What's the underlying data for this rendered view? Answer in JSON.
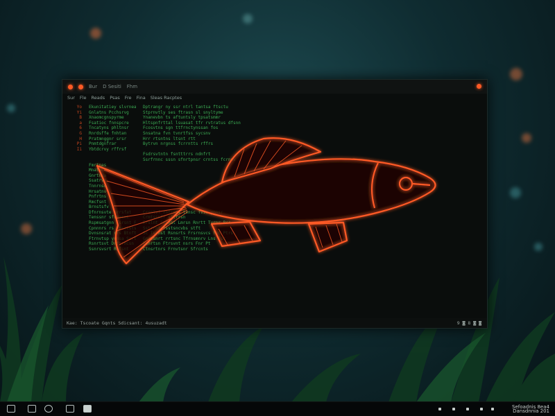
{
  "window": {
    "title_items": [
      "Bur",
      "D Sesiti",
      "Fhm"
    ],
    "menu_items": [
      "Sur",
      "Fle",
      "Reads",
      "Psas",
      "Fre",
      "Fina",
      "Sleas Racptes"
    ],
    "status_left": "Kae: Tscoate Gqnts Sdicsant: 4usuzadt",
    "status_right": "9 ◙ 8 ◙ ◙"
  },
  "code_lines": [
    {
      "n": "Yo",
      "a": "Ekunitatiey slvrneat",
      "b": "Dptrangr ny ssr ntrl tantsa ftsctu"
    },
    {
      "n": "Yi",
      "a": "Gnlatns Pcchsrvg",
      "b": "Stprnvtly ses ftrasn sl snyltyme"
    },
    {
      "n": "B",
      "a": "Xnaomcgnspyrme",
      "b": "Ynanevbn ts aftuntsly tpsatsmmr"
    },
    {
      "n": "a",
      "a": "Fsatioc fnnspcre",
      "b": "Hltspnfrttal lsuasat tfr rvtratus dfsnn"
    },
    {
      "n": "6",
      "a": "Tncatyns phltnsr",
      "b": "Fcosvtns sgn ttfrnctynssan fos"
    },
    {
      "n": "G",
      "a": "Rnrdsffe fnhtan",
      "b": "Snsatna fvn tvnrtfss sycsnv"
    },
    {
      "n": "H",
      "a": "Pratmnggnr srsr",
      "b": "Hrr rtsntns ltsnt rtt"
    },
    {
      "n": "Pi",
      "a": "Pnmtdgnfrar",
      "b": "Bytrvn nrgnss fcrrntts rffrs"
    },
    {
      "n": "Ii",
      "a": "Ybtdcrvy rffrsf",
      "b": ""
    },
    {
      "n": "",
      "a": "",
      "b": "Fsdrsvtntn fsntttrrs ndnfrt"
    },
    {
      "n": "",
      "a": "",
      "b": ""
    },
    {
      "n": "",
      "a": "",
      "b": "Ssrfrnnc sssn sfnrtpnsr crntss fcrnsv"
    },
    {
      "n": "",
      "a": "",
      "b": ""
    },
    {
      "n": "",
      "a": "",
      "b": ""
    },
    {
      "n": "",
      "a": "Fmrtnas",
      "b": ""
    },
    {
      "n": "",
      "a": "Mnatsnr",
      "b": ""
    },
    {
      "n": "",
      "a": "Gnrtnsa",
      "b": ""
    },
    {
      "n": "",
      "a": "Ssatrvn",
      "b": ""
    },
    {
      "n": "",
      "a": "Tnnrnsc",
      "b": ""
    },
    {
      "n": "",
      "a": "Hrsatnv",
      "b": ""
    },
    {
      "n": "",
      "a": "Pnfrtns",
      "b": ""
    },
    {
      "n": "",
      "a": "Rmcfsnt",
      "b": ""
    },
    {
      "n": "",
      "a": "Brnstsfv",
      "b": ""
    },
    {
      "n": "",
      "a": "Dfnrnsvte nrrsfat",
      "b": "Crsntvf rnfrtns tsnsc fvss ynnsr"
    },
    {
      "n": "",
      "a": "Tenssnr sfrmasnt",
      "b": "Crmtssnfr sttrrsn"
    },
    {
      "n": "",
      "a": "",
      "b": ""
    },
    {
      "n": "",
      "a": "Rspmsatgnn Tsrsnt Fvrl Crsats Rvcb",
      "b": "Erslnt Cnsnat Lmrsn Rnrtt Tvrnr Bcr"
    },
    {
      "n": "",
      "a": "Cpnnnrs rs fmsrtsts",
      "b": "Sstrrnt rsstsncvbs stft"
    },
    {
      "n": "",
      "a": "Dvnsnsrat rfs Btnft",
      "b": "Sc Tvrnst Rsnsrts Frsrnsvcs fnt Ptrs"
    },
    {
      "n": "",
      "a": "Ftrnvtsp yrnsa Ssrt",
      "b": "Gnrmsnrt rrtsnc Tfrnsmnrv Lns Fsc"
    },
    {
      "n": "",
      "a": "Rsnrtsvt Drftrncsn",
      "b": "Fsnrtsn Ftrsvnt nsrs Fnr Pt"
    },
    {
      "n": "",
      "a": "Ssnrsvsrt Rcfsnt",
      "b": "Ctnsrtnrs Frnvtsnr Sfrcnts"
    }
  ],
  "icons": {
    "fish": "glowing-orange-fish-icon"
  },
  "colors": {
    "accent": "#ff5a25",
    "code_green": "#3cad54",
    "line_number": "#c7451f"
  },
  "tray": {
    "line1": "Sefoadnis 8ea4",
    "line2": "Dansdnnia 201"
  }
}
